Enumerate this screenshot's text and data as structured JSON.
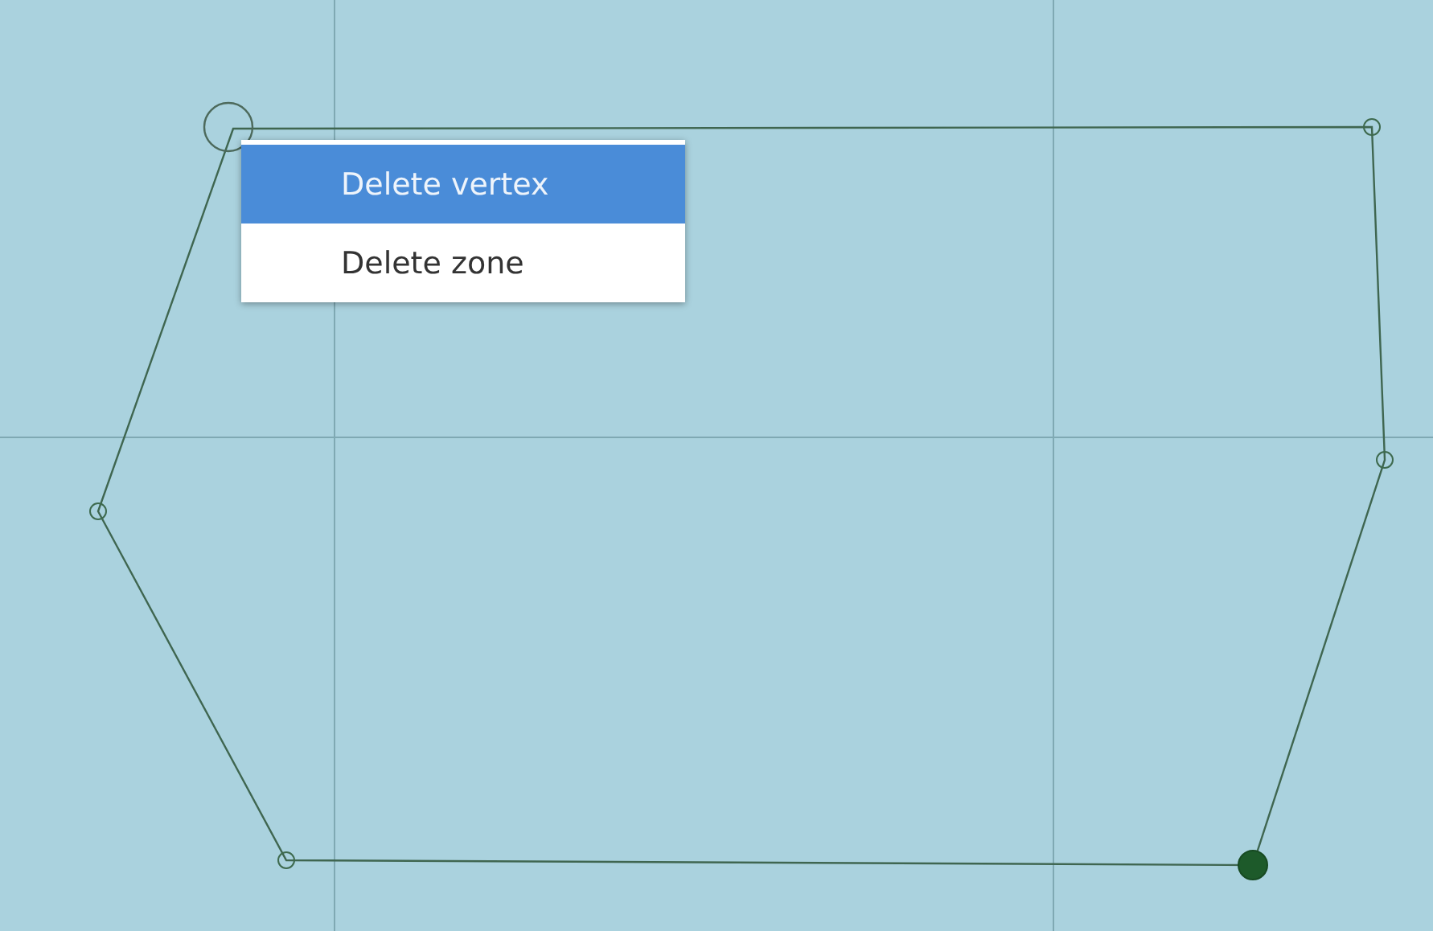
{
  "zone": {
    "vertices": [
      {
        "kind": "targeted"
      },
      {
        "kind": "plain"
      },
      {
        "kind": "plain"
      },
      {
        "kind": "active"
      },
      {
        "kind": "plain"
      },
      {
        "kind": "plain"
      }
    ]
  },
  "context_menu": {
    "items": [
      {
        "label": "Delete vertex",
        "selected": true
      },
      {
        "label": "Delete zone",
        "selected": false
      }
    ]
  }
}
